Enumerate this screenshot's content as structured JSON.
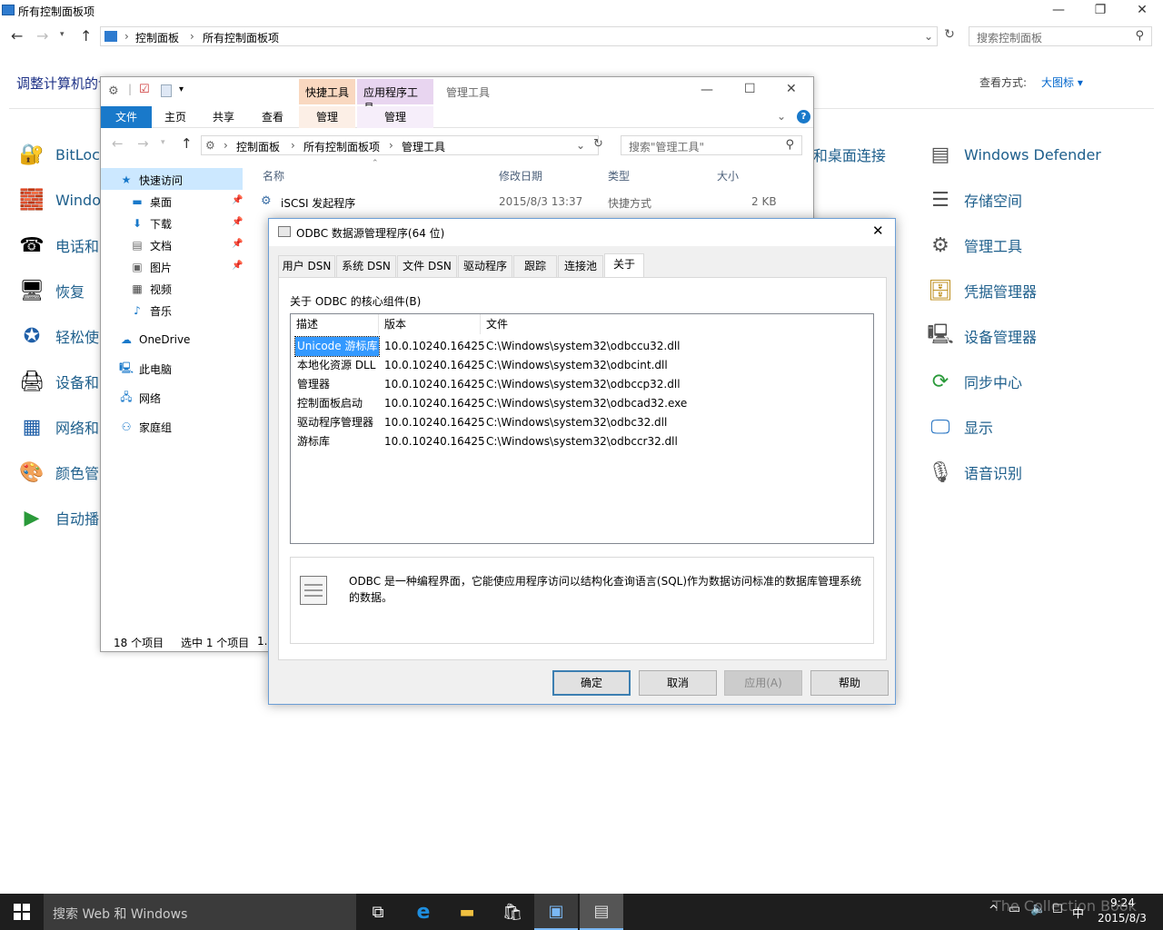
{
  "control_panel": {
    "title": "所有控制面板项",
    "breadcrumb": [
      "控制面板",
      "所有控制面板项"
    ],
    "search_placeholder": "搜索控制面板",
    "heading": "调整计算机的设置",
    "view_label": "查看方式:",
    "view_value": "大图标 ▾",
    "left_items": [
      "BitLocker",
      "Windows",
      "电话和",
      "恢复",
      "轻松使",
      "设备和",
      "网络和",
      "颜色管",
      "自动播"
    ],
    "mid_item": "o 和桌面连接",
    "right_items": [
      "Windows Defender",
      "存储空间",
      "管理工具",
      "凭据管理器",
      "设备管理器",
      "同步中心",
      "显示",
      "语音识别"
    ]
  },
  "explorer": {
    "context_tab_1": "快捷工具",
    "context_tab_2": "应用程序工具",
    "window_title": "管理工具",
    "ribbon_tabs": [
      "文件",
      "主页",
      "共享",
      "查看",
      "管理",
      "管理"
    ],
    "breadcrumb": [
      "控制面板",
      "所有控制面板项",
      "管理工具"
    ],
    "search_placeholder": "搜索\"管理工具\"",
    "nav": {
      "quick_access": "快速访问",
      "items": [
        "桌面",
        "下载",
        "文档",
        "图片",
        "视频",
        "音乐"
      ],
      "onedrive": "OneDrive",
      "this_pc": "此电脑",
      "network": "网络",
      "homegroup": "家庭组"
    },
    "columns": [
      "名称",
      "修改日期",
      "类型",
      "大小"
    ],
    "first_file": {
      "name": "iSCSI 发起程序",
      "date": "2015/8/3 13:37",
      "type": "快捷方式",
      "size": "2 KB"
    },
    "status_count": "18 个项目",
    "status_selected": "选中 1 个项目",
    "status_extra": "1."
  },
  "dialog": {
    "title": "ODBC 数据源管理程序(64 位)",
    "tabs": [
      "用户 DSN",
      "系统 DSN",
      "文件 DSN",
      "驱动程序",
      "跟踪",
      "连接池",
      "关于"
    ],
    "group_label": "关于 ODBC 的核心组件(B)",
    "columns": [
      "描述",
      "版本",
      "文件"
    ],
    "rows": [
      {
        "desc": "Unicode 游标库",
        "version": "10.0.10240.16425",
        "file": "C:\\Windows\\system32\\odbccu32.dll"
      },
      {
        "desc": "本地化资源 DLL",
        "version": "10.0.10240.16425",
        "file": "C:\\Windows\\system32\\odbcint.dll"
      },
      {
        "desc": "管理器",
        "version": "10.0.10240.16425",
        "file": "C:\\Windows\\system32\\odbccp32.dll"
      },
      {
        "desc": "控制面板启动",
        "version": "10.0.10240.16425",
        "file": "C:\\Windows\\system32\\odbcad32.exe"
      },
      {
        "desc": "驱动程序管理器",
        "version": "10.0.10240.16425",
        "file": "C:\\Windows\\system32\\odbc32.dll"
      },
      {
        "desc": "游标库",
        "version": "10.0.10240.16425",
        "file": "C:\\Windows\\system32\\odbccr32.dll"
      }
    ],
    "description_line1": "ODBC 是一种编程界面，它能使应用程序访问以结构化查询语言(SQL)作为数据访问标准的数据库管理系统",
    "description_line2": "的数据。",
    "buttons": {
      "ok": "确定",
      "cancel": "取消",
      "apply": "应用(A)",
      "help": "帮助"
    }
  },
  "taskbar": {
    "search_text": "搜索 Web 和 Windows",
    "time": "9:24",
    "date": "2015/8/3",
    "ime": "中",
    "watermark": "The Collection Book"
  }
}
